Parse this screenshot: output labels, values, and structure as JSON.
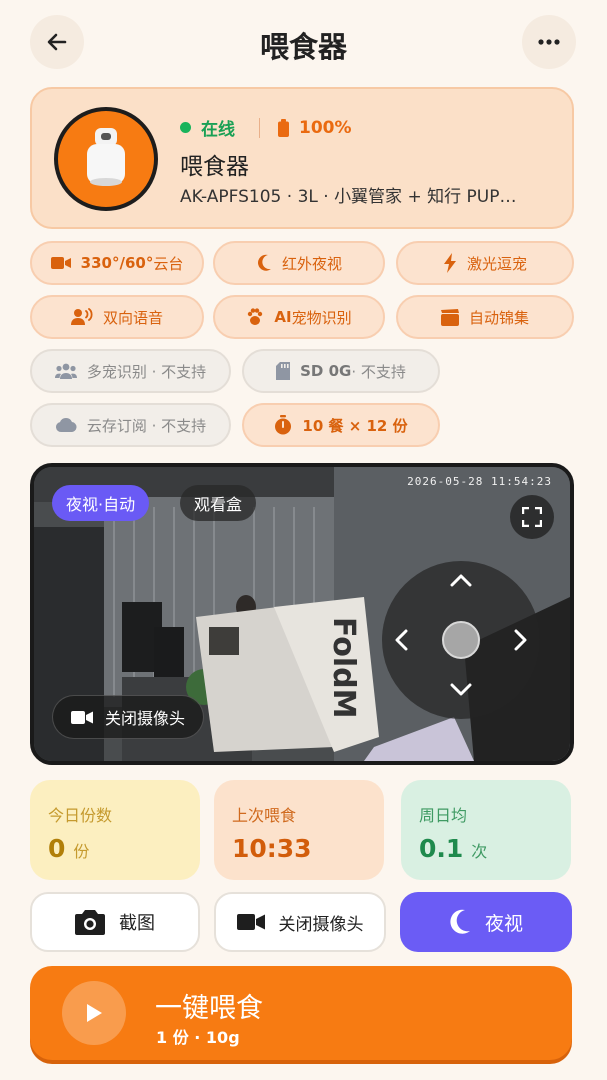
{
  "header": {
    "title": "喂食器"
  },
  "device": {
    "online_text": "在线",
    "battery_text": "100%",
    "name": "喂食器",
    "model": "AK-APFS105 · 3L · 小翼管家 + 知行 PUP…"
  },
  "features": [
    {
      "label": "330°/60°",
      "suffix": " 云台",
      "icon": "video-camera-icon",
      "supported": true
    },
    {
      "label": "红外夜视",
      "icon": "moon-icon",
      "supported": true
    },
    {
      "label": "激光逗宠",
      "icon": "lightning-icon",
      "supported": true
    },
    {
      "label": "双向语音",
      "icon": "speaking-person-icon",
      "supported": true
    },
    {
      "label": "AI",
      "suffix": " 宠物识别",
      "icon": "paw-icon",
      "supported": true
    },
    {
      "label": "自动锦集",
      "icon": "film-clapper-icon",
      "supported": true
    },
    {
      "label": "多宠识别 · 不支持",
      "icon": "multiple-users-icon",
      "supported": false
    },
    {
      "label": "SD 0G",
      "suffix": " · 不支持",
      "icon": "sd-card-icon",
      "supported": false
    },
    {
      "label": "云存订阅 · 不支持",
      "icon": "cloud-icon",
      "supported": false
    },
    {
      "label": "10 餐 × 12 份",
      "icon": "timer-icon",
      "supported": true
    }
  ],
  "video": {
    "night_mode_badge": "夜视·自动",
    "watch_box_badge": "观看盒",
    "timestamp": "2026-05-28  11:54:23",
    "close_camera_label": "关闭摄像头"
  },
  "stats": {
    "today": {
      "label": "今日份数",
      "value": "0",
      "unit": "份"
    },
    "last": {
      "label": "上次喂食",
      "value": "10:33"
    },
    "week": {
      "label": "周日均",
      "value": "0.1",
      "unit": "次"
    }
  },
  "actions": {
    "screenshot_label": "截图",
    "close_camera_label": "关闭摄像头",
    "night_label": "夜视"
  },
  "feed": {
    "title": "一键喂食",
    "subtitle": "1 份 · 10g"
  },
  "colors": {
    "accent_orange": "#f77b12",
    "accent_purple": "#6b5cf5",
    "online_green": "#19b35c",
    "background": "#fcf6ef"
  }
}
